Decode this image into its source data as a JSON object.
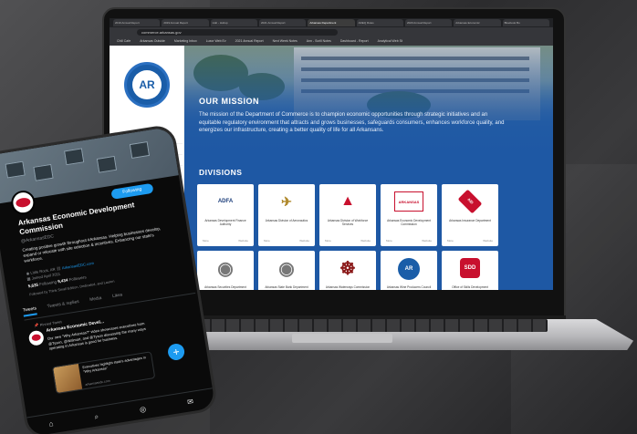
{
  "browser": {
    "tabs": [
      "2019 Annual Report",
      "2019 Annual Report",
      "Hub - Hubsp",
      "2021 Annual Report",
      "Arkansas Department",
      "ADEQ Rules",
      "2020 Annual Report",
      "Arkansas Economic",
      "Bluebook Bu"
    ],
    "url": "commerce.arkansas.gov",
    "bookmarks": [
      "Chill Cafe",
      "Arkansas Outside",
      "Marketing Inbox",
      "Luxor Web Ev",
      "2021 Annual Report",
      "Next Week Notes",
      "Ann - Scrill Notes",
      "Dashboard - Report",
      "Analytical Web St"
    ]
  },
  "site": {
    "logo_text": "AR",
    "nav": [
      "About",
      "Divisions",
      "Secretary's Office",
      "Dashboard",
      "News",
      "Contact"
    ],
    "mission_title": "OUR MISSION",
    "mission_text": "The mission of the Department of Commerce is to champion economic opportunities through strategic initiatives and an equitable regulatory environment that attracts and grows businesses, safeguards consumers, enhances workforce quality, and energizes our infrastructure, creating a better quality of life for all Arkansans.",
    "divisions_title": "DIVISIONS",
    "divisions": [
      {
        "logo": "ADFA",
        "name": "Arkansas Development Finance Authority",
        "more": "More",
        "website": "Website"
      },
      {
        "logo": "✈",
        "name": "Arkansas Division of Aeronautics",
        "more": "More",
        "website": "Website"
      },
      {
        "logo": "▲",
        "name": "Arkansas Division of Workforce Services",
        "more": "More",
        "website": "Website"
      },
      {
        "logo": "ARKANSAS",
        "name": "Arkansas Economic Development Commission",
        "more": "More",
        "website": "Website"
      },
      {
        "logo": "AID",
        "name": "Arkansas Insurance Department",
        "more": "More",
        "website": "Website"
      },
      {
        "logo": "◉",
        "name": "Arkansas Securities Department",
        "more": "More",
        "website": "Website"
      },
      {
        "logo": "◉",
        "name": "Arkansas State Bank Department",
        "more": "More",
        "website": "Website"
      },
      {
        "logo": "☸",
        "name": "Arkansas Waterways Commission",
        "more": "More",
        "website": "Website"
      },
      {
        "logo": "AR",
        "name": "Arkansas Wine Producers Council",
        "more": "More",
        "website": "Website"
      },
      {
        "logo": "SDD",
        "name": "Office of Skills Development",
        "more": "More",
        "website": "Website"
      }
    ]
  },
  "twitter": {
    "edit_label": "Following",
    "name": "Arkansas Economic Development Commission",
    "handle": "@ArkansasEDC",
    "bio": "Creating positive growth throughout #Arkansas. Helping businesses develop, expand or relocate with site selection & incentives. Enhancing our state's workforce.",
    "location": "Little Rock, AR",
    "website": "ArkansasEDC.com",
    "joined": "Joined April 2011",
    "following_count": "5,635",
    "following_label": "Following",
    "followers_count": "9,434",
    "followers_label": "Followers",
    "followed_by": "Followed by Think Small Edition, Dedicated, and Lauren",
    "tabs": [
      "Tweets",
      "Tweets & replies",
      "Media",
      "Likes"
    ],
    "pinned": "Pinned Tweet",
    "tweet_author": "Arkansas Economic Devel...",
    "tweet_text": "Our new \"Why Arkansas?\" video showcases executives from @Tyson, @Walmart, and @Tyson discussing the many ways operating in Arkansas is good for business.",
    "card_text": "Executives highlight state's advantages in \"Why Arkansas\"",
    "card_url": "arkansasedc.com",
    "fab": "+",
    "nav_icons": [
      "⌂",
      "⌕",
      "◎",
      "✉"
    ]
  }
}
